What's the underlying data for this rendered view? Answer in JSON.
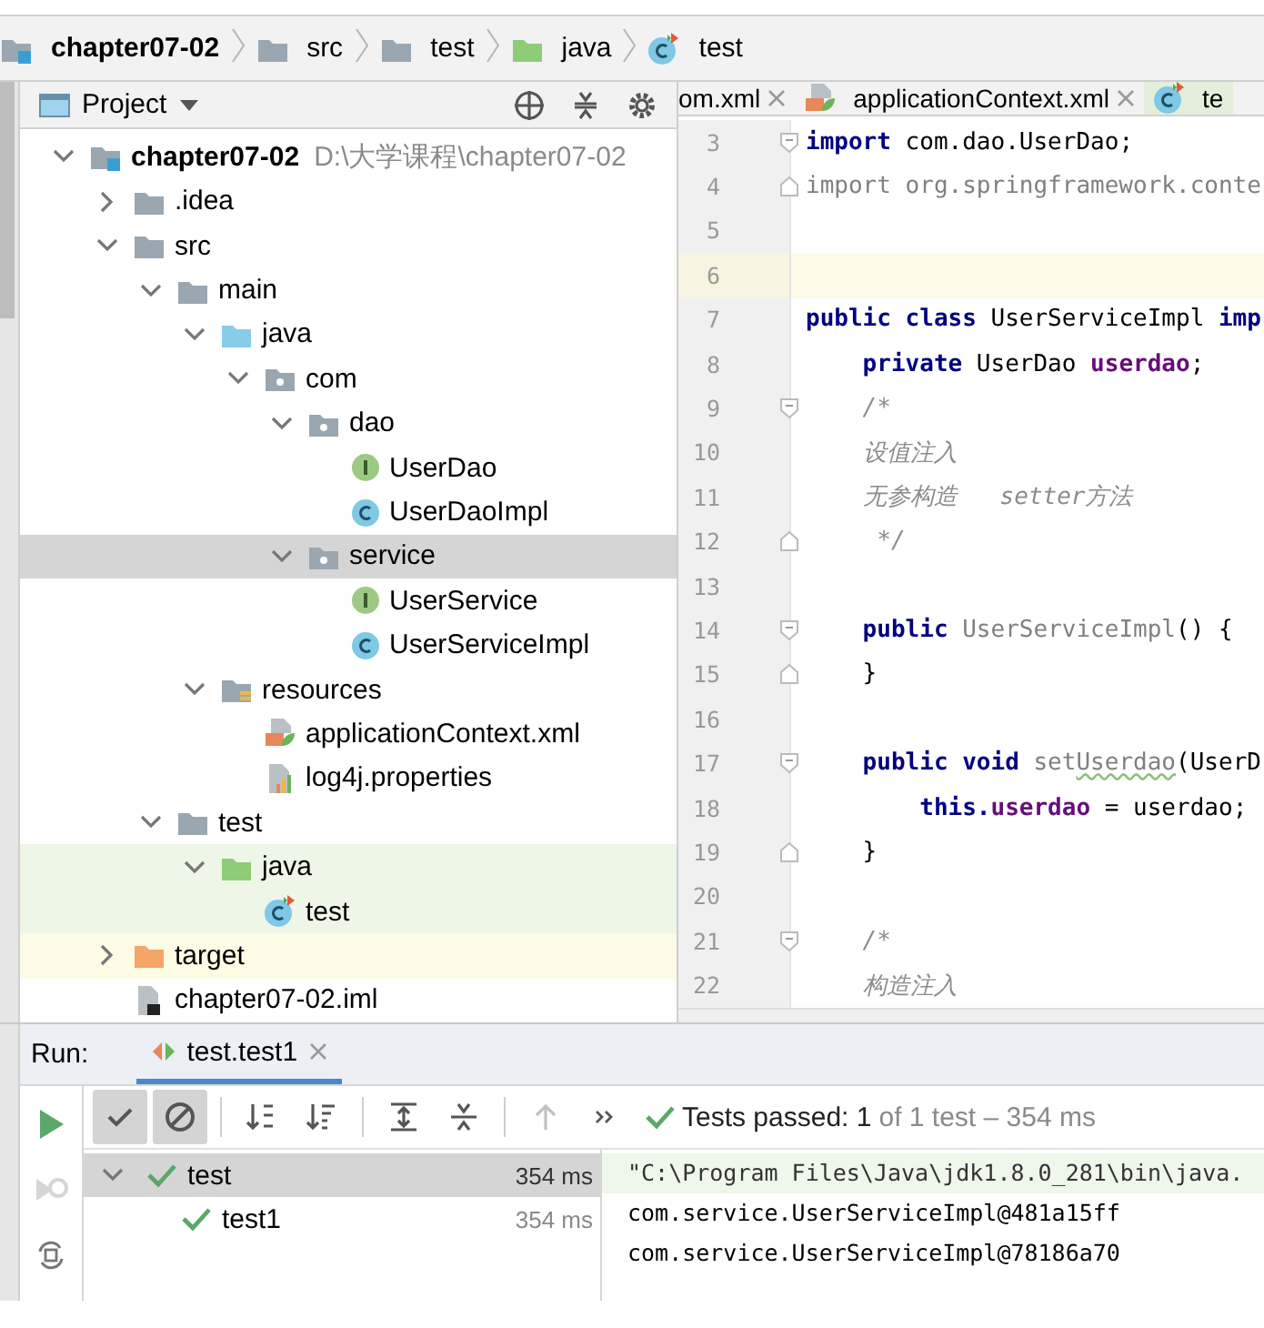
{
  "breadcrumbs": [
    {
      "label": "chapter07-02",
      "kind": "module"
    },
    {
      "label": "src",
      "kind": "folder"
    },
    {
      "label": "test",
      "kind": "folder"
    },
    {
      "label": "java",
      "kind": "test-folder"
    },
    {
      "label": "test",
      "kind": "test-class"
    }
  ],
  "project_panel": {
    "title": "Project",
    "tree": [
      {
        "label": "chapter07-02",
        "path": "D:\\大学课程\\chapter07-02",
        "kind": "module",
        "expanded": true,
        "selected": false,
        "children": [
          {
            "label": ".idea",
            "kind": "folder",
            "expanded": false,
            "selected": false
          },
          {
            "label": "src",
            "kind": "folder",
            "expanded": true,
            "selected": false,
            "children": [
              {
                "label": "main",
                "kind": "folder",
                "expanded": true,
                "selected": false,
                "children": [
                  {
                    "label": "java",
                    "kind": "source-folder",
                    "expanded": true,
                    "selected": false,
                    "children": [
                      {
                        "label": "com",
                        "kind": "package",
                        "expanded": true,
                        "selected": false,
                        "children": [
                          {
                            "label": "dao",
                            "kind": "package",
                            "expanded": true,
                            "selected": false,
                            "children": [
                              {
                                "label": "UserDao",
                                "kind": "interface",
                                "selected": false
                              },
                              {
                                "label": "UserDaoImpl",
                                "kind": "class",
                                "selected": false
                              }
                            ]
                          },
                          {
                            "label": "service",
                            "kind": "package",
                            "expanded": true,
                            "selected": true,
                            "children": [
                              {
                                "label": "UserService",
                                "kind": "interface",
                                "selected": false
                              },
                              {
                                "label": "UserServiceImpl",
                                "kind": "class",
                                "selected": false
                              }
                            ]
                          }
                        ]
                      }
                    ]
                  },
                  {
                    "label": "resources",
                    "kind": "resources",
                    "expanded": true,
                    "selected": false,
                    "children": [
                      {
                        "label": "applicationContext.xml",
                        "kind": "spring-xml",
                        "selected": false
                      },
                      {
                        "label": "log4j.properties",
                        "kind": "properties",
                        "selected": false
                      }
                    ]
                  }
                ]
              },
              {
                "label": "test",
                "kind": "folder",
                "expanded": true,
                "selected": false,
                "children": [
                  {
                    "label": "java",
                    "kind": "test-folder",
                    "expanded": true,
                    "selected": false,
                    "children": [
                      {
                        "label": "test",
                        "kind": "test-class",
                        "selected": false
                      }
                    ]
                  }
                ]
              }
            ]
          },
          {
            "label": "target",
            "kind": "excluded-folder",
            "expanded": false,
            "selected": false
          },
          {
            "label": "chapter07-02.iml",
            "kind": "iml",
            "selected": false
          }
        ]
      }
    ]
  },
  "editor": {
    "tabs": [
      {
        "label": "om.xml",
        "selected": false
      },
      {
        "label": "applicationContext.xml",
        "kind": "spring-xml",
        "selected": false
      },
      {
        "label": "te",
        "kind": "test-class",
        "selected": true
      }
    ],
    "lines": [
      {
        "number": "3",
        "current": false,
        "fold_start": true,
        "fold_end": false,
        "tokens": [
          {
            "kind": "keyword",
            "text": "import"
          },
          {
            "kind": "plain",
            "text": " com.dao.UserDao;"
          }
        ]
      },
      {
        "number": "4",
        "current": false,
        "fold_start": false,
        "fold_end": true,
        "tokens": [
          {
            "kind": "unused",
            "text": "import org.springframework.conte"
          }
        ]
      },
      {
        "number": "5",
        "current": false,
        "fold_start": false,
        "fold_end": false
      },
      {
        "number": "6",
        "current": true,
        "fold_start": false,
        "fold_end": false
      },
      {
        "number": "7",
        "current": false,
        "fold_start": false,
        "fold_end": false,
        "tokens": [
          {
            "kind": "keyword",
            "text": "public class"
          },
          {
            "kind": "plain",
            "text": " UserServiceImpl "
          },
          {
            "kind": "keyword",
            "text": "imp"
          }
        ]
      },
      {
        "number": "8",
        "current": false,
        "fold_start": false,
        "fold_end": false,
        "tokens": [
          {
            "kind": "keyword",
            "text": "    private"
          },
          {
            "kind": "plain",
            "text": " UserDao "
          },
          {
            "kind": "field",
            "text": "userdao"
          },
          {
            "kind": "plain",
            "text": ";"
          }
        ]
      },
      {
        "number": "9",
        "current": false,
        "fold_start": true,
        "fold_end": false,
        "tokens": [
          {
            "kind": "comment",
            "text": "    /*"
          }
        ]
      },
      {
        "number": "10",
        "current": false,
        "fold_start": false,
        "fold_end": false,
        "tokens": [
          {
            "kind": "comment",
            "text": "    设值注入"
          }
        ]
      },
      {
        "number": "11",
        "current": false,
        "fold_start": false,
        "fold_end": false,
        "tokens": [
          {
            "kind": "comment",
            "text": "    无参构造   setter方法"
          }
        ]
      },
      {
        "number": "12",
        "current": false,
        "fold_start": false,
        "fold_end": true,
        "tokens": [
          {
            "kind": "comment",
            "text": "     */"
          }
        ]
      },
      {
        "number": "13",
        "current": false,
        "fold_start": false,
        "fold_end": false
      },
      {
        "number": "14",
        "current": false,
        "fold_start": true,
        "fold_end": false,
        "tokens": [
          {
            "kind": "keyword",
            "text": "    public"
          },
          {
            "kind": "unused",
            "text": " UserServiceImpl"
          },
          {
            "kind": "plain",
            "text": "() {"
          }
        ]
      },
      {
        "number": "15",
        "current": false,
        "fold_start": false,
        "fold_end": true,
        "tokens": [
          {
            "kind": "plain",
            "text": "    }"
          }
        ]
      },
      {
        "number": "16",
        "current": false,
        "fold_start": false,
        "fold_end": false
      },
      {
        "number": "17",
        "current": false,
        "fold_start": true,
        "fold_end": false,
        "tokens": [
          {
            "kind": "keyword",
            "text": "    public void"
          },
          {
            "kind": "unused",
            "text": " set"
          },
          {
            "kind": "typo",
            "text": "Userdao"
          },
          {
            "kind": "plain",
            "text": "(UserD"
          }
        ]
      },
      {
        "number": "18",
        "current": false,
        "fold_start": false,
        "fold_end": false,
        "tokens": [
          {
            "kind": "keyword",
            "text": "        this."
          },
          {
            "kind": "field",
            "text": "userdao"
          },
          {
            "kind": "plain",
            "text": " = userdao;"
          }
        ]
      },
      {
        "number": "19",
        "current": false,
        "fold_start": false,
        "fold_end": true,
        "tokens": [
          {
            "kind": "plain",
            "text": "    }"
          }
        ]
      },
      {
        "number": "20",
        "current": false,
        "fold_start": false,
        "fold_end": false
      },
      {
        "number": "21",
        "current": false,
        "fold_start": true,
        "fold_end": false,
        "tokens": [
          {
            "kind": "comment",
            "text": "    /*"
          }
        ]
      },
      {
        "number": "22",
        "current": false,
        "fold_start": false,
        "fold_end": false,
        "tokens": [
          {
            "kind": "comment",
            "text": "    构造注入"
          }
        ]
      }
    ]
  },
  "run_panel": {
    "title": "Run:",
    "tabs": [
      {
        "label": "test.test1",
        "selected": true
      }
    ],
    "side_tools": [
      {
        "kind": "rerun",
        "disabled": false
      },
      {
        "kind": "rerun-failed",
        "disabled": true
      },
      {
        "kind": "auto-test",
        "disabled": false
      }
    ],
    "tools": [
      {
        "kind": "show-passed",
        "on": true,
        "disabled": false
      },
      {
        "kind": "show-ignored",
        "on": true,
        "disabled": false
      },
      {
        "kind": "sort-alpha",
        "on": false,
        "disabled": false
      },
      {
        "kind": "sort-duration",
        "on": false,
        "disabled": false
      },
      {
        "kind": "expand-all",
        "on": false,
        "disabled": false
      },
      {
        "kind": "collapse-all",
        "on": false,
        "disabled": false
      },
      {
        "kind": "previous",
        "on": false,
        "disabled": true
      },
      {
        "kind": "more",
        "on": false,
        "disabled": false
      }
    ],
    "status": {
      "passed": "Tests passed: 1",
      "detail": "of 1 test – 354 ms"
    },
    "tests": [
      {
        "name": "test",
        "time": "354 ms",
        "passed": true,
        "expanded": true,
        "selected": true,
        "children": [
          {
            "name": "test1",
            "time": "354 ms",
            "passed": true,
            "selected": false
          }
        ]
      }
    ],
    "console": [
      {
        "kind": "command",
        "text": "\"C:\\Program Files\\Java\\jdk1.8.0_281\\bin\\java."
      },
      {
        "kind": "output",
        "text": "com.service.UserServiceImpl@481a15ff"
      },
      {
        "kind": "output",
        "text": "com.service.UserServiceImpl@78186a70"
      }
    ]
  }
}
